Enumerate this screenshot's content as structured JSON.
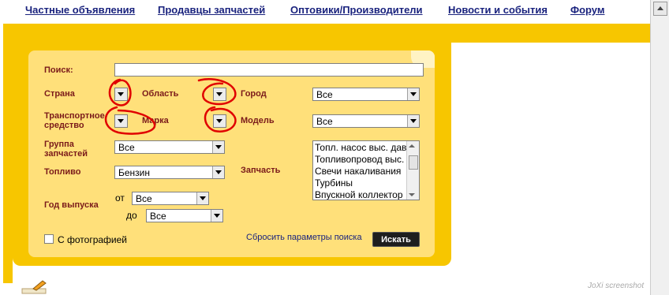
{
  "nav": {
    "items": [
      "Частные объявления",
      "Продавцы запчастей",
      "Оптовики/Производители",
      "Новости и события",
      "Форум"
    ]
  },
  "search_form": {
    "search_label": "Поиск:",
    "search_value": "",
    "country_label": "Страна",
    "region_label": "Область",
    "city_label": "Город",
    "city_value": "Все",
    "vehicle_label": "Транспортное средство",
    "brand_label": "Марка",
    "model_label": "Модель",
    "model_value": "Все",
    "parts_group_label": "Группа запчастей",
    "parts_group_value": "Все",
    "fuel_label": "Топливо",
    "fuel_value": "Бензин",
    "part_label": "Запчасть",
    "parts_list": [
      "Топл. насос выс. дав",
      "Топливопровод выс.",
      "Свечи накаливания",
      "Турбины",
      "Впускной коллектор"
    ],
    "year_label": "Год выпуска",
    "year_from_label": "от",
    "year_from_value": "Все",
    "year_to_label": "до",
    "year_to_value": "Все",
    "photo_label": "С фотографией",
    "reset_label": "Сбросить параметры поиска",
    "search_button": "Искать"
  },
  "watermark": "JoXi screenshot",
  "colors": {
    "accent_yellow": "#f7c600",
    "panel_yellow": "#ffe07a",
    "label_red": "#7a1a1a",
    "annotation_red": "#e00000"
  }
}
